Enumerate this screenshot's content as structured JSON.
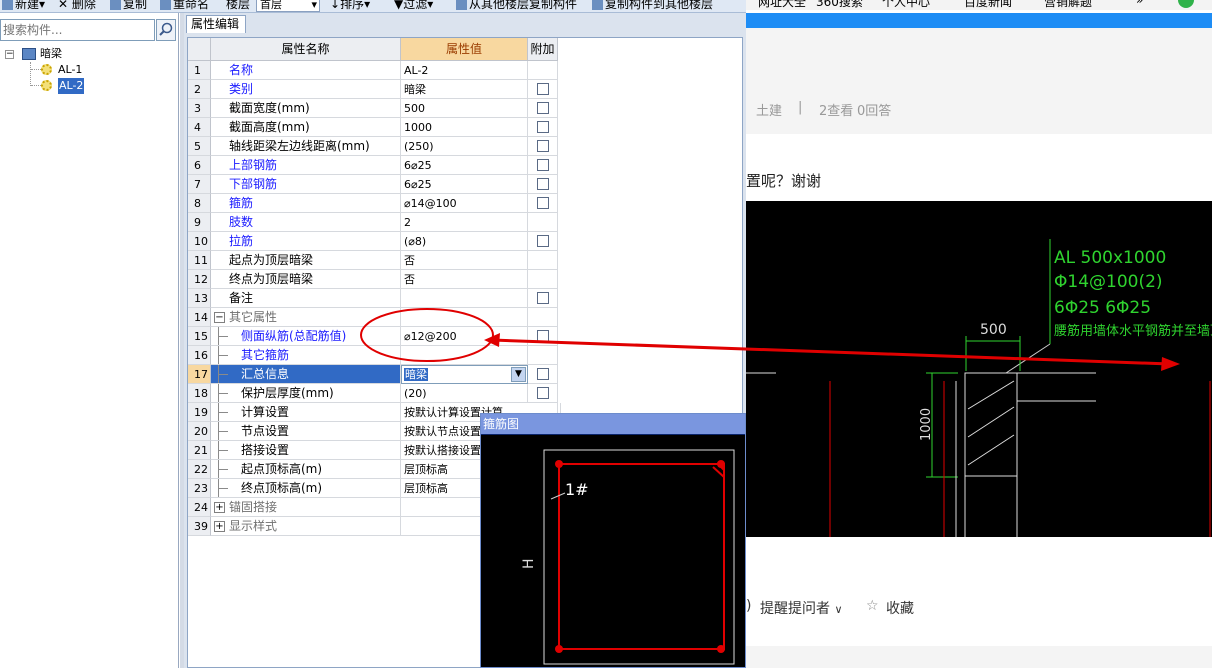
{
  "toolbar": {
    "new_label": "新建",
    "delete_label": "删除",
    "copy_label": "复制",
    "rename_label": "重命名",
    "floor_label": "楼层",
    "floor_value": "首层",
    "sort_label": "排序",
    "filter_label": "过滤",
    "copy_from_label": "从其他楼层复制构件",
    "copy_to_label": "复制构件到其他楼层"
  },
  "search": {
    "placeholder": "搜索构件..."
  },
  "tree": {
    "root_label": "暗梁",
    "items": [
      {
        "label": "AL-1"
      },
      {
        "label": "AL-2"
      }
    ]
  },
  "editor": {
    "tab_label": "属性编辑",
    "col_index": "",
    "col_name": "属性名称",
    "col_value": "属性值",
    "col_extra": "附加",
    "rows": [
      {
        "num": "1",
        "name": "名称",
        "value": "AL-2"
      },
      {
        "num": "2",
        "name": "类别",
        "value": "暗梁"
      },
      {
        "num": "3",
        "name": "截面宽度(mm)",
        "value": "500"
      },
      {
        "num": "4",
        "name": "截面高度(mm)",
        "value": "1000"
      },
      {
        "num": "5",
        "name": "轴线距梁左边线距离(mm)",
        "value": "(250)"
      },
      {
        "num": "6",
        "name": "上部钢筋",
        "value": "6⌀25"
      },
      {
        "num": "7",
        "name": "下部钢筋",
        "value": "6⌀25"
      },
      {
        "num": "8",
        "name": "箍筋",
        "value": "⌀14@100"
      },
      {
        "num": "9",
        "name": "肢数",
        "value": "2"
      },
      {
        "num": "10",
        "name": "拉筋",
        "value": "(⌀8)"
      },
      {
        "num": "11",
        "name": "起点为顶层暗梁",
        "value": "否"
      },
      {
        "num": "12",
        "name": "终点为顶层暗梁",
        "value": "否"
      },
      {
        "num": "13",
        "name": "备注",
        "value": ""
      },
      {
        "num": "14",
        "name": "其它属性",
        "value": "",
        "expander": "−"
      },
      {
        "num": "15",
        "name": "侧面纵筋(总配筋值)",
        "value": "⌀12@200"
      },
      {
        "num": "16",
        "name": "其它箍筋",
        "value": ""
      },
      {
        "num": "17",
        "name": "汇总信息",
        "value": "暗梁"
      },
      {
        "num": "18",
        "name": "保护层厚度(mm)",
        "value": "(20)"
      },
      {
        "num": "19",
        "name": "计算设置",
        "value": "按默认计算设置计算"
      },
      {
        "num": "20",
        "name": "节点设置",
        "value": "按默认节点设置计算"
      },
      {
        "num": "21",
        "name": "搭接设置",
        "value": "按默认搭接设置计算"
      },
      {
        "num": "22",
        "name": "起点顶标高(m)",
        "value": "层顶标高"
      },
      {
        "num": "23",
        "name": "终点顶标高(m)",
        "value": "层顶标高"
      },
      {
        "num": "24",
        "name": "锚固搭接",
        "value": "",
        "expander": "+"
      },
      {
        "num": "39",
        "name": "显示样式",
        "value": "",
        "expander": "+"
      }
    ]
  },
  "stirrup_window": {
    "title": "箍筋图",
    "label_1": "1#",
    "label_h": "H"
  },
  "webpage": {
    "browser_links": [
      "网址大全",
      "360搜索",
      "个人中心",
      "百度新闻",
      "营销解题",
      "»"
    ],
    "meta_category": "土建",
    "meta_sep": "|",
    "meta_views": "2查看",
    "meta_answers": "0回答",
    "question_fragment": "置呢？谢谢",
    "cad_text_1": "AL 500x1000",
    "cad_text_2": "Φ14@100(2)",
    "cad_text_3": "6Φ25 6Φ25",
    "cad_text_4": "腰筋用墙体水平钢筋并至墙顶",
    "cad_dim_w": "500",
    "cad_dim_h": "1000",
    "remind_label": "提醒提问者",
    "remind_prefix": ")",
    "remind_arrow": "∨",
    "star_icon": "☆",
    "collect_label": "收藏"
  },
  "colors": {
    "accent_red": "#e00000",
    "selection": "#316ac5",
    "header_value": "#f8d8a0",
    "browser_blue": "#1e8df5"
  }
}
